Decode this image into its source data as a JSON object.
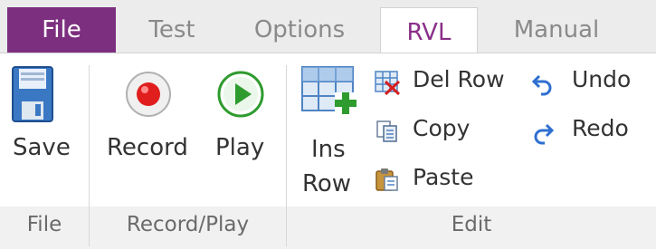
{
  "tabs": {
    "file": "File",
    "test": "Test",
    "options": "Options",
    "rvl": "RVL",
    "manual": "Manual"
  },
  "buttons": {
    "save": "Save",
    "record": "Record",
    "play": "Play",
    "ins_row_line1": "Ins",
    "ins_row_line2": "Row",
    "del_row": "Del Row",
    "copy": "Copy",
    "paste": "Paste",
    "undo": "Undo",
    "redo": "Redo"
  },
  "groups": {
    "file": "File",
    "record_play": "Record/Play",
    "edit": "Edit"
  },
  "colors": {
    "file_tab": "#7d2f7f",
    "active_tab_text": "#8a2f88",
    "record": "#e01e1e",
    "play": "#2e9b2e",
    "undo_redo": "#2f6fd0"
  }
}
